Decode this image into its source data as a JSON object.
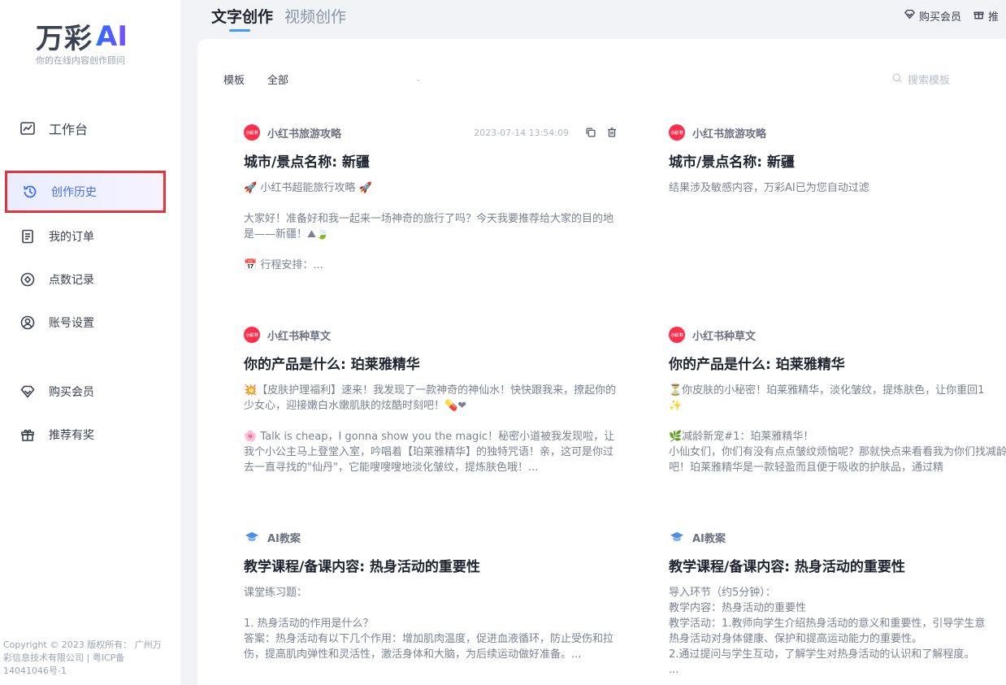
{
  "sidebar": {
    "logo_text": "万彩",
    "logo_ai": "AI",
    "tagline": "你的在线内容创作顾问",
    "items": [
      {
        "label": "工作台",
        "icon": "chart-line-icon"
      },
      {
        "label": "创作历史",
        "icon": "history-icon"
      },
      {
        "label": "我的订单",
        "icon": "order-list-icon"
      },
      {
        "label": "点数记录",
        "icon": "points-record-icon"
      },
      {
        "label": "账号设置",
        "icon": "account-icon"
      },
      {
        "label": "购买会员",
        "icon": "diamond-icon"
      },
      {
        "label": "推荐有奖",
        "icon": "gift-icon"
      }
    ],
    "copyright": "Copyright © 2023 版权所有：  广州万彩信息技术有限公司 | 粤ICP备14041046号-1"
  },
  "tabs": [
    {
      "label": "文字创作"
    },
    {
      "label": "视频创作"
    }
  ],
  "top_actions": {
    "buy_member": "购买会员",
    "recommend": "推"
  },
  "filter": {
    "label": "模板",
    "selected": "全部",
    "search_placeholder": "搜索模板"
  },
  "cards": [
    {
      "category": "小红书旅游攻略",
      "category_icon": "xiaohongshu-icon",
      "time": "2023-07-14 13:54:09",
      "title": "城市/景点名称: 新疆",
      "body": "🚀 小红书超能旅行攻略 🚀\n\n大家好！准备好和我一起来一场神奇的旅行了吗？今天我要推荐给大家的目的地是——新疆！⛰🍃\n\n📅 行程安排：..."
    },
    {
      "category": "小红书旅游攻略",
      "category_icon": "xiaohongshu-icon",
      "title": "城市/景点名称: 新疆",
      "body": "结果涉及敏感内容，万彩AI已为您自动过滤"
    },
    {
      "category": "小红书种草文",
      "category_icon": "xiaohongshu-icon",
      "title": "你的产品是什么: 珀莱雅精华",
      "body": "💥【皮肤护理福利】速来！我发现了一款神奇的神仙水！快快跟我来，撩起你的少女心，迎接嫩白水嫩肌肤的炫酷时刻吧！💊❤\n\n🌸 Talk is cheap，I gonna show you the magic！秘密小道被我发现啦，让我个小公主马上登堂入室，吟唱着【珀莱雅精华】的独特咒语！亲，这可是你过去一直寻找的\"仙丹\"，它能嗖嗖嗖地淡化皱纹，提炼肤色哦！..."
    },
    {
      "category": "小红书种草文",
      "category_icon": "xiaohongshu-icon",
      "title": "你的产品是什么: 珀莱雅精华",
      "body": "⏳你皮肤的小秘密！珀莱雅精华，淡化皱纹，提炼肤色，让你重回1\n✨\n\n🌿减龄新宠#1：珀莱雅精华！\n小仙女们，你们有没有点点皱纹烦恼呢？那就快点来看看我为你们找减龄神器吧！珀莱雅精华是一款轻盈而且便于吸收的护肤品，通过精"
    },
    {
      "category": "AI教案",
      "category_icon": "graduation-cap-icon",
      "title": "教学课程/备课内容: 热身活动的重要性",
      "body": "课堂练习题：\n\n1. 热身活动的作用是什么？\n答案：热身活动有以下几个作用：增加肌肉温度，促进血液循环，防止受伤和拉伤，提高肌肉弹性和灵活性，激活身体和大脑，为后续运动做好准备。..."
    },
    {
      "category": "AI教案",
      "category_icon": "graduation-cap-icon",
      "title": "教学课程/备课内容: 热身活动的重要性",
      "body": "导入环节（约5分钟）：\n教学内容：热身活动的重要性\n教学活动：1.教师向学生介绍热身活动的意义和重要性，引导学生意\n热身活动对身体健康、保护和提高运动能力的重要性。\n2.通过提问与学生互动，了解学生对热身活动的认识和了解程度。\n..."
    }
  ]
}
